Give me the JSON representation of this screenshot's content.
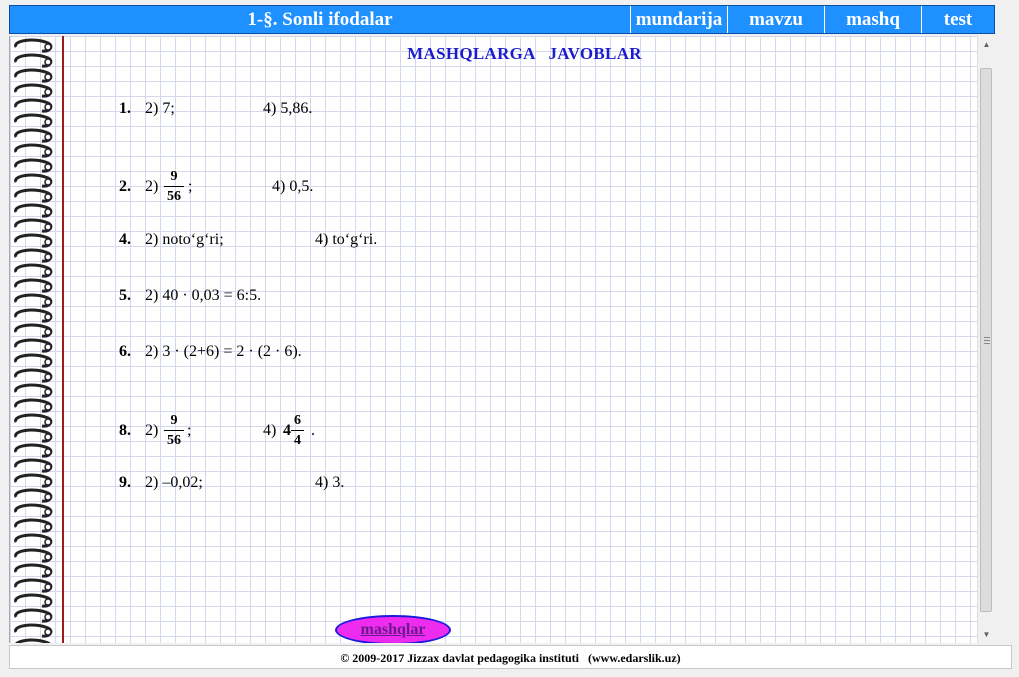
{
  "header": {
    "title": "1-§. Sonli ifodalar",
    "nav": [
      "mundarija",
      "mavzu",
      "mashq",
      "test"
    ],
    "color": "#1e90ff"
  },
  "content": {
    "title": "MASHQLARGA   JAVOBLAR",
    "answers": {
      "a1": {
        "num": "1.",
        "p1": "2) 7;",
        "p2": "4) 5,86."
      },
      "a2": {
        "num": "2.",
        "p1_label": "2)",
        "p1_num": "9",
        "p1_den": "56",
        "p1_suffix": ";",
        "p2": "4) 0,5."
      },
      "a4": {
        "num": "4.",
        "p1": "2) noto‘g‘ri;",
        "p2": "4) to‘g‘ri."
      },
      "a5": {
        "num": "5.",
        "p1": "2) 40 · 0,03 = 6:5."
      },
      "a6": {
        "num": "6.",
        "p1": "2) 3 · (2+6) = 2 · (2 · 6)."
      },
      "a8": {
        "num": "8.",
        "p1_label": "2)",
        "p1_num": "9",
        "p1_den": "56",
        "p1_suffix": ";",
        "p2_label": "4)",
        "p2_whole": "4",
        "p2_num": "6",
        "p2_den": "4",
        "p2_suffix": "."
      },
      "a9": {
        "num": "9.",
        "p1": "2) –0,02;",
        "p2": "4) 3."
      }
    },
    "button_label": "mashqlar"
  },
  "footer": {
    "text": "© 2009-2017 Jizzax davlat pedagogika instituti   (www.edarslik.uz)"
  },
  "scrollbar": {
    "up_icon": "triangle-up",
    "down_icon": "triangle-down"
  }
}
